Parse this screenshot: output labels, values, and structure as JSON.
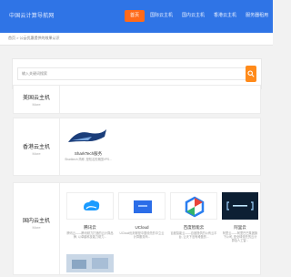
{
  "header": {
    "site_title": "中国云计算导航网",
    "nav": [
      "首页",
      "国际云主机",
      "国内云主机",
      "香港云主机",
      "服务器租用"
    ]
  },
  "breadcrumb": "首页 > 公云优惠提供的效果认识",
  "search": {
    "placeholder": "输入关键词搜索"
  },
  "sections": [
    {
      "title": "美国云主机",
      "sub": "More"
    },
    {
      "title": "香港云主机",
      "sub": "More"
    },
    {
      "title": "国内云主机",
      "sub": "More"
    }
  ],
  "hk_card": {
    "name": "SharkTech服务",
    "desc": "Sharktech 简称, 是知名的美国VPS..."
  },
  "cn_cards": [
    {
      "name": "腾讯云",
      "desc": "腾讯云——腾讯倾力打造的云计算品牌, 以卓越科技能力助力..."
    },
    {
      "name": "UCloud",
      "desc": "UCloud优刻得是中国领先的中立云计算服务商..."
    },
    {
      "name": "百度智能云",
      "desc": "百度智能云——百度提供的公有云平台, 让天下没有难做的..."
    },
    {
      "name": "阿里云",
      "desc": "阿里云——阿里巴巴集团旗下公司, 是全球领先的云计算及人工智..."
    }
  ],
  "colors": {
    "brand": "#2f74e6",
    "accent": "#ff6a1a"
  }
}
